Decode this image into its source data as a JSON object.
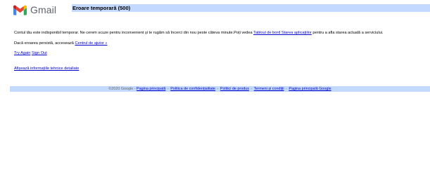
{
  "header": {
    "logo_text": "Gmail",
    "title": "Eroare temporară (500)",
    "title_bar_color": "#c3d9ff"
  },
  "main": {
    "line1_text": "Contul tău este indisponibil temporar. Ne cerem scuze pentru inconvenient și te rugăm să încerci din nou peste câteva minute.Poți vedea ",
    "line1_link": "Tabloul de bord Starea aplicațiilor",
    "line1_suffix": " pentru a afla starea actuală a serviciului.",
    "line2_text": "Dacă eroarea persistă, accesează ",
    "line2_link": "Centrul de ajutor »",
    "try_again": "Try Again",
    "sign_out": "Sign Out",
    "details_link": "Afișează informațiile tehnice detaliate"
  },
  "footer": {
    "copyright": "©2020 Google - ",
    "links": [
      "Pagina principală",
      "Politica de confidențialitate",
      "Politici de produs",
      "Termeni și condiții",
      "Pagina principală Google"
    ],
    "separator": " - "
  },
  "icons": {
    "logo": "gmail-m-icon"
  }
}
